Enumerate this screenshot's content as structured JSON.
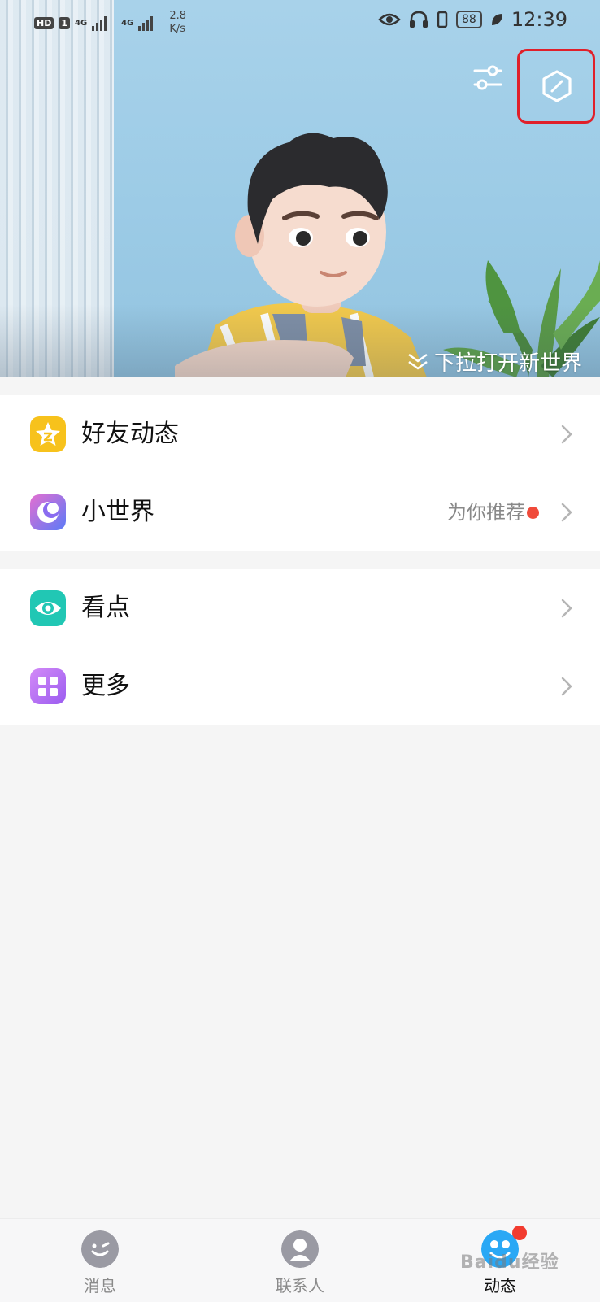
{
  "status_bar": {
    "hd_badge": "HD",
    "sim1": "1",
    "net1": "4G",
    "net2": "4G",
    "speed_value": "2.8",
    "speed_unit": "K/s",
    "battery": "88",
    "time": "12:39"
  },
  "hero": {
    "pull_hint": "下拉打开新世界"
  },
  "groups": {
    "first": [
      {
        "label": "好友动态",
        "icon": "qzone-star-icon",
        "color": "#f7c21c"
      },
      {
        "label": "小世界",
        "icon": "small-world-icon",
        "color": "#8a6cf0",
        "extra": "为你推荐"
      }
    ],
    "second": [
      {
        "label": "看点",
        "icon": "eye-icon",
        "color": "#21c7b4"
      },
      {
        "label": "更多",
        "icon": "grid-icon",
        "color": "#b46cf2"
      }
    ]
  },
  "bottom_nav": {
    "items": [
      {
        "label": "消息",
        "icon": "message-icon"
      },
      {
        "label": "联系人",
        "icon": "contacts-icon"
      },
      {
        "label": "动态",
        "icon": "feed-icon",
        "active": true
      }
    ]
  },
  "watermark": "Baidu经验",
  "colors": {
    "red_dot": "#f04a3a",
    "highlight_box": "#e0202a",
    "accent_blue": "#2aa8f5"
  }
}
